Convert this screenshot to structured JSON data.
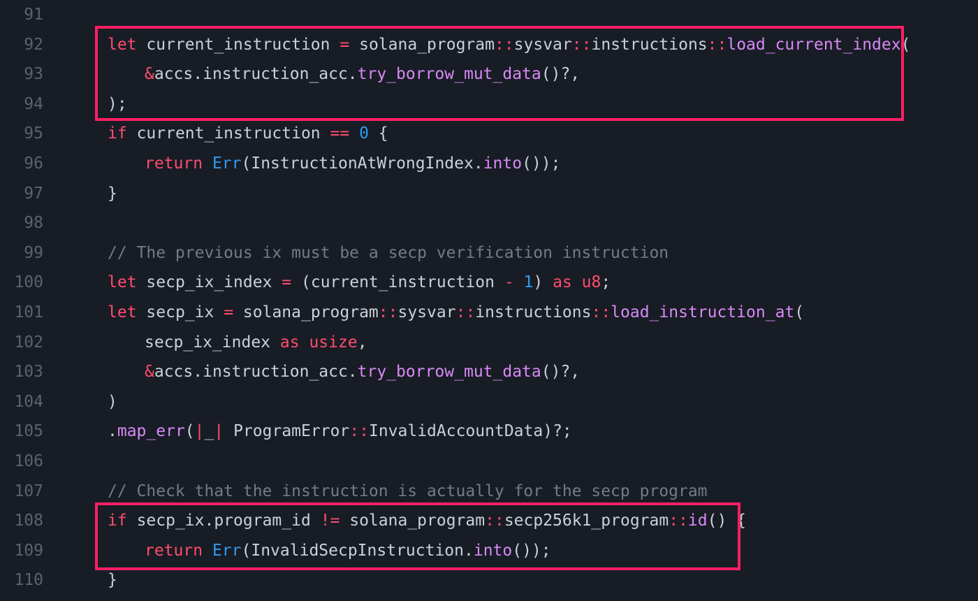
{
  "colors": {
    "background": "#181c25",
    "line_number": "#5b6270",
    "text": "#c9d1d9",
    "keyword": "#ff4d6d",
    "function": "#d78af5",
    "type": "#2f9bf0",
    "number": "#2f9bf0",
    "comment": "#737b89",
    "highlight_border": "#ff1f65"
  },
  "highlights": [
    {
      "name": "highlight-load-current-index",
      "from_line": 92,
      "to_line": 94
    },
    {
      "name": "highlight-program-id-check",
      "from_line": 108,
      "to_line": 109
    }
  ],
  "lines": [
    {
      "n": "91",
      "indent": 0,
      "tokens": []
    },
    {
      "n": "92",
      "indent": 0,
      "tokens": [
        [
          "kw",
          "let"
        ],
        [
          "p",
          " "
        ],
        [
          "id",
          "current_instruction"
        ],
        [
          "p",
          " "
        ],
        [
          "op",
          "="
        ],
        [
          "p",
          " "
        ],
        [
          "id",
          "solana_program"
        ],
        [
          "op",
          "::"
        ],
        [
          "id",
          "sysvar"
        ],
        [
          "op",
          "::"
        ],
        [
          "id",
          "instructions"
        ],
        [
          "op",
          "::"
        ],
        [
          "fn",
          "load_current_index"
        ],
        [
          "p",
          "("
        ]
      ]
    },
    {
      "n": "93",
      "indent": 1,
      "tokens": [
        [
          "op",
          "&"
        ],
        [
          "id",
          "accs.instruction_acc."
        ],
        [
          "fn",
          "try_borrow_mut_data"
        ],
        [
          "p",
          "()?,"
        ]
      ]
    },
    {
      "n": "94",
      "indent": 0,
      "tokens": [
        [
          "p",
          ");"
        ]
      ]
    },
    {
      "n": "95",
      "indent": 0,
      "tokens": [
        [
          "kw",
          "if"
        ],
        [
          "p",
          " "
        ],
        [
          "id",
          "current_instruction"
        ],
        [
          "p",
          " "
        ],
        [
          "op",
          "=="
        ],
        [
          "p",
          " "
        ],
        [
          "num",
          "0"
        ],
        [
          "p",
          " {"
        ]
      ]
    },
    {
      "n": "96",
      "indent": 1,
      "tokens": [
        [
          "kw",
          "return"
        ],
        [
          "p",
          " "
        ],
        [
          "ty",
          "Err"
        ],
        [
          "p",
          "("
        ],
        [
          "id",
          "InstructionAtWrongIndex."
        ],
        [
          "fn",
          "into"
        ],
        [
          "p",
          "());"
        ]
      ]
    },
    {
      "n": "97",
      "indent": 0,
      "tokens": [
        [
          "p",
          "}"
        ]
      ]
    },
    {
      "n": "98",
      "indent": 0,
      "tokens": []
    },
    {
      "n": "99",
      "indent": 0,
      "tokens": [
        [
          "cm",
          "// The previous ix must be a secp verification instruction"
        ]
      ]
    },
    {
      "n": "100",
      "indent": 0,
      "tokens": [
        [
          "kw",
          "let"
        ],
        [
          "p",
          " "
        ],
        [
          "id",
          "secp_ix_index"
        ],
        [
          "p",
          " "
        ],
        [
          "op",
          "="
        ],
        [
          "p",
          " ("
        ],
        [
          "id",
          "current_instruction"
        ],
        [
          "p",
          " "
        ],
        [
          "op",
          "-"
        ],
        [
          "p",
          " "
        ],
        [
          "num",
          "1"
        ],
        [
          "p",
          ") "
        ],
        [
          "kw",
          "as"
        ],
        [
          "p",
          " "
        ],
        [
          "kw",
          "u8"
        ],
        [
          "p",
          ";"
        ]
      ]
    },
    {
      "n": "101",
      "indent": 0,
      "tokens": [
        [
          "kw",
          "let"
        ],
        [
          "p",
          " "
        ],
        [
          "id",
          "secp_ix"
        ],
        [
          "p",
          " "
        ],
        [
          "op",
          "="
        ],
        [
          "p",
          " "
        ],
        [
          "id",
          "solana_program"
        ],
        [
          "op",
          "::"
        ],
        [
          "id",
          "sysvar"
        ],
        [
          "op",
          "::"
        ],
        [
          "id",
          "instructions"
        ],
        [
          "op",
          "::"
        ],
        [
          "fn",
          "load_instruction_at"
        ],
        [
          "p",
          "("
        ]
      ]
    },
    {
      "n": "102",
      "indent": 1,
      "tokens": [
        [
          "id",
          "secp_ix_index"
        ],
        [
          "p",
          " "
        ],
        [
          "kw",
          "as"
        ],
        [
          "p",
          " "
        ],
        [
          "kw",
          "usize"
        ],
        [
          "p",
          ","
        ]
      ]
    },
    {
      "n": "103",
      "indent": 1,
      "tokens": [
        [
          "op",
          "&"
        ],
        [
          "id",
          "accs.instruction_acc."
        ],
        [
          "fn",
          "try_borrow_mut_data"
        ],
        [
          "p",
          "()?,"
        ]
      ]
    },
    {
      "n": "104",
      "indent": 0,
      "tokens": [
        [
          "p",
          ")"
        ]
      ]
    },
    {
      "n": "105",
      "indent": 0,
      "tokens": [
        [
          "p",
          "."
        ],
        [
          "fn",
          "map_err"
        ],
        [
          "p",
          "("
        ],
        [
          "op",
          "|"
        ],
        [
          "id",
          "_"
        ],
        [
          "op",
          "|"
        ],
        [
          "p",
          " "
        ],
        [
          "id",
          "ProgramError"
        ],
        [
          "op",
          "::"
        ],
        [
          "id",
          "InvalidAccountData"
        ],
        [
          "p",
          ")?;"
        ]
      ]
    },
    {
      "n": "106",
      "indent": 0,
      "tokens": []
    },
    {
      "n": "107",
      "indent": 0,
      "tokens": [
        [
          "cm",
          "// Check that the instruction is actually for the secp program"
        ]
      ]
    },
    {
      "n": "108",
      "indent": 0,
      "tokens": [
        [
          "kw",
          "if"
        ],
        [
          "p",
          " "
        ],
        [
          "id",
          "secp_ix.program_id"
        ],
        [
          "p",
          " "
        ],
        [
          "op",
          "!="
        ],
        [
          "p",
          " "
        ],
        [
          "id",
          "solana_program"
        ],
        [
          "op",
          "::"
        ],
        [
          "id",
          "secp256k1_program"
        ],
        [
          "op",
          "::"
        ],
        [
          "fn",
          "id"
        ],
        [
          "p",
          "() {"
        ]
      ]
    },
    {
      "n": "109",
      "indent": 1,
      "tokens": [
        [
          "kw",
          "return"
        ],
        [
          "p",
          " "
        ],
        [
          "ty",
          "Err"
        ],
        [
          "p",
          "("
        ],
        [
          "id",
          "InvalidSecpInstruction."
        ],
        [
          "fn",
          "into"
        ],
        [
          "p",
          "());"
        ]
      ]
    },
    {
      "n": "110",
      "indent": 0,
      "tokens": [
        [
          "p",
          "}"
        ]
      ]
    }
  ]
}
